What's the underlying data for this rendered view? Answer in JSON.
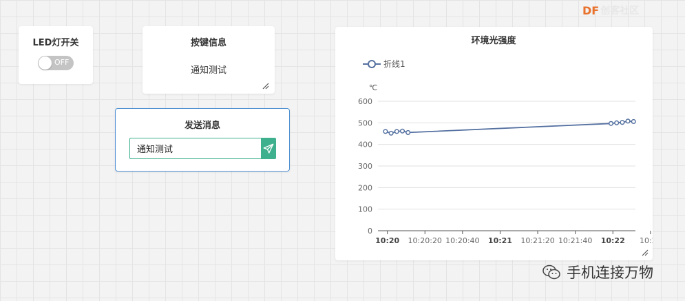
{
  "brand": {
    "logo_text": "DF",
    "name": "创客社区"
  },
  "led_card": {
    "title": "LED灯开关",
    "toggle_state": "OFF"
  },
  "key_card": {
    "title": "按键信息",
    "value": "通知测试"
  },
  "send_card": {
    "title": "发送消息",
    "input_value": "通知测试",
    "send_icon": "paper-plane-icon"
  },
  "chart_card": {
    "title": "环境光强度"
  },
  "chart_data": {
    "type": "line",
    "title": "环境光强度",
    "unit_label": "℃",
    "legend_position": "top-left",
    "series": [
      {
        "name": "折线1",
        "color": "#5470a0",
        "points": [
          {
            "x": "10:19:59",
            "y": 460
          },
          {
            "x": "10:20:02",
            "y": 452
          },
          {
            "x": "10:20:05",
            "y": 460
          },
          {
            "x": "10:20:08",
            "y": 462
          },
          {
            "x": "10:20:11",
            "y": 455
          },
          {
            "x": "10:21:59",
            "y": 497
          },
          {
            "x": "10:22:02",
            "y": 500
          },
          {
            "x": "10:22:05",
            "y": 502
          },
          {
            "x": "10:22:08",
            "y": 508
          },
          {
            "x": "10:22:11",
            "y": 506
          }
        ]
      }
    ],
    "x_start": "10:19:55",
    "x_end": "10:22:12",
    "x_ticks": [
      {
        "time": "10:20:00",
        "label": "10:20",
        "bold": true
      },
      {
        "time": "10:20:20",
        "label": "10:20:20",
        "bold": false
      },
      {
        "time": "10:20:40",
        "label": "10:20:40",
        "bold": false
      },
      {
        "time": "10:21:00",
        "label": "10:21",
        "bold": true
      },
      {
        "time": "10:21:20",
        "label": "10:21:20",
        "bold": false
      },
      {
        "time": "10:21:40",
        "label": "10:21:40",
        "bold": false
      },
      {
        "time": "10:22:00",
        "label": "10:22",
        "bold": true
      },
      {
        "time": "10:22:20",
        "label": "10:22",
        "bold": false
      }
    ],
    "ylim": [
      0,
      600
    ],
    "y_ticks": [
      0,
      100,
      200,
      300,
      400,
      500,
      600
    ],
    "grid": true
  },
  "footer": {
    "text": "手机连接万物",
    "icon": "wechat-icon"
  }
}
